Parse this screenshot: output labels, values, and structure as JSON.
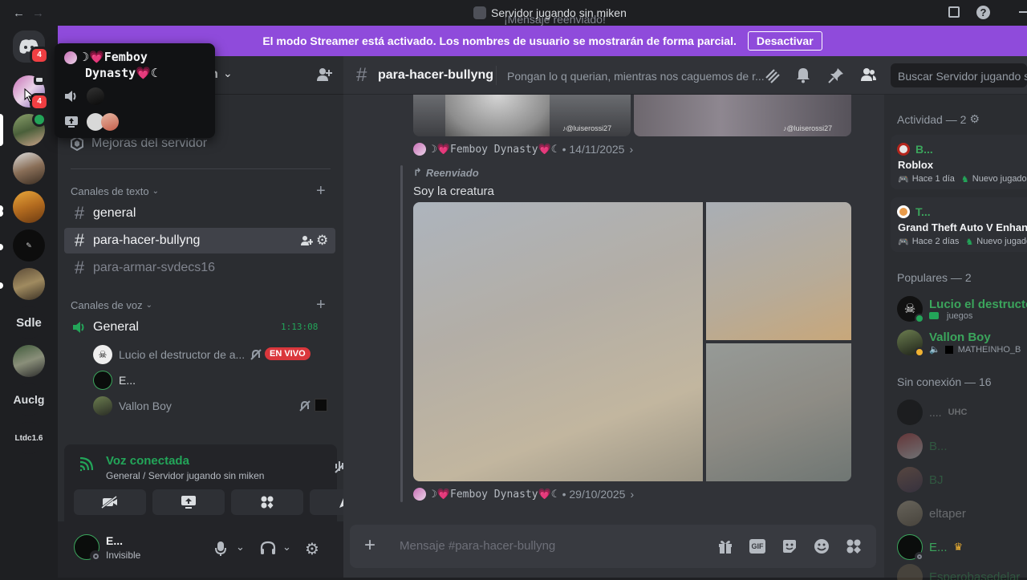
{
  "window": {
    "title": "Servidor jugando sin miken",
    "toast": "¡Mensaje reenviado!",
    "back_icon": "←",
    "forward_icon": "→"
  },
  "banner": {
    "text": "El modo Streamer está activado. Los nombres de usuario se mostrarán de forma parcial.",
    "button": "Desactivar",
    "color": "#8f4bdb"
  },
  "rail": {
    "badges": [
      "4",
      "4"
    ],
    "text_servers": [
      "Sdle",
      "Auclg",
      "Ltdc1.6"
    ]
  },
  "popover": {
    "name_line1": "☽💗Femboy",
    "name_line2": "Dynasty💗☾"
  },
  "sidebar": {
    "server_name_suffix": "n",
    "boosts": "Mejoras del servidor",
    "text_category": "Canales de texto",
    "text_channels": [
      "general",
      "para-hacer-bullyng",
      "para-armar-svdecs16"
    ],
    "voice_category": "Canales de voz",
    "voice_channel": "General",
    "voice_timer": "1:13:08",
    "voice_users": [
      {
        "name": "Lucio el destructor de a...",
        "live": "EN VIVO"
      },
      {
        "name": "E..."
      },
      {
        "name": "Vallon Boy"
      }
    ]
  },
  "voice_panel": {
    "status": "Voz conectada",
    "location": "General / Servidor jugando sin miken"
  },
  "user_panel": {
    "name": "E...",
    "status": "Invisible"
  },
  "channel_header": {
    "name": "para-hacer-bullyng",
    "topic": "Pongan lo q querian, mientras nos caguemos de r...",
    "search_placeholder": "Buscar Servidor jugando sin miken"
  },
  "messages": {
    "watermark": "♪@luiserossi27",
    "first_author": "☽💗Femboy Dynasty💗☾",
    "first_date": "• 14/11/2025",
    "forwarded_label": "Reenviado",
    "forwarded_text": "Soy la creatura",
    "second_author": "☽💗Femboy Dynasty💗☾",
    "second_date": "• 29/10/2025"
  },
  "composer": {
    "placeholder": "Mensaje #para-hacer-bullyng"
  },
  "members": {
    "activity_title": "Actividad — 2",
    "activities": [
      {
        "user": "B...",
        "game": "Roblox",
        "time": "Hace 1 día",
        "tag": "Nuevo jugador"
      },
      {
        "user": "T...",
        "game": "Grand Theft Auto V Enhanced",
        "time": "Hace 2 días",
        "tag": "Nuevo jugador"
      }
    ],
    "popular_title": "Populares — 2",
    "popular": [
      {
        "name": "Lucio el destructor",
        "sub": "juegos"
      },
      {
        "name": "Vallon Boy",
        "sub": "MATHEINHO_B"
      }
    ],
    "offline_title": "Sin conexión — 16",
    "offline": [
      {
        "name": "....",
        "tag": "UHC"
      },
      {
        "name": "B..."
      },
      {
        "name": "BJ"
      },
      {
        "name": "eltaper"
      },
      {
        "name": "E..."
      },
      {
        "name": "Esperobasedelar"
      }
    ],
    "online_color": "#23a559",
    "offline_name_color": "#3ba55c"
  }
}
